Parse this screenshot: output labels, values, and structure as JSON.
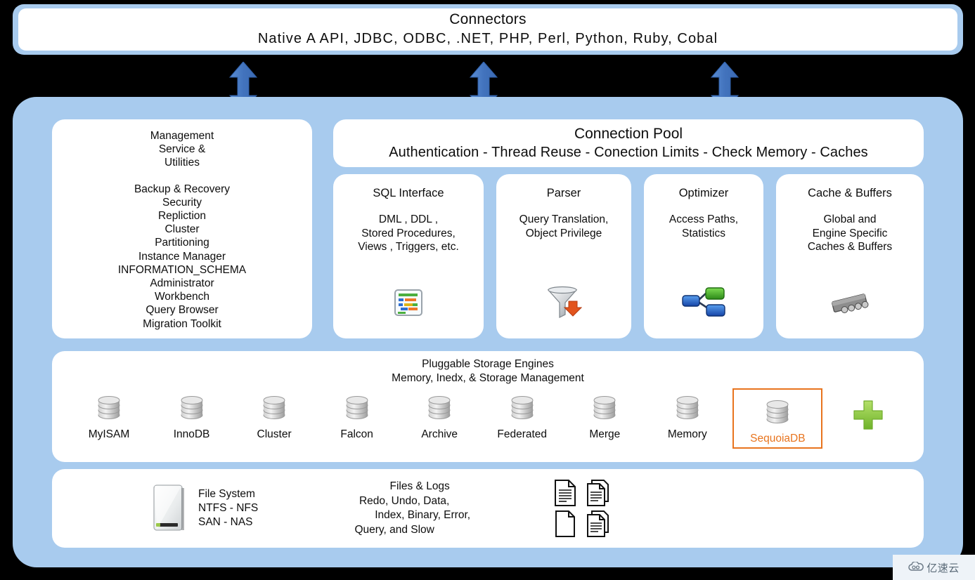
{
  "connectors": {
    "title": "Connectors",
    "list": "Native A API,  JDBC,  ODBC,  .NET,  PHP,  Perl,  Python,  Ruby,  Cobal"
  },
  "arrows": {
    "icon": "double-headed-vertical-arrow",
    "color": "#4a7ec7",
    "count": 3
  },
  "management": {
    "heading_lines": [
      "Management",
      "Service &",
      "Utilities"
    ],
    "items": [
      "Backup & Recovery",
      "Security",
      "Repliction",
      "Cluster",
      "Partitioning",
      "Instance Manager",
      "INFORMATION_SCHEMA",
      "Administrator",
      "Workbench",
      "Query Browser",
      "Migration Toolkit"
    ]
  },
  "connection_pool": {
    "title": "Connection Pool",
    "subtitle": "Authentication - Thread Reuse - Conection Limits - Check Memory - Caches"
  },
  "cards": [
    {
      "title": "SQL Interface",
      "body": [
        "DML , DDL ,",
        "Stored Procedures,",
        "Views , Triggers, etc."
      ],
      "icon": "gantt-chart-icon"
    },
    {
      "title": "Parser",
      "body": [
        "Query Translation,",
        "Object Privilege"
      ],
      "icon": "funnel-download-icon"
    },
    {
      "title": "Optimizer",
      "body": [
        "Access Paths,",
        "Statistics"
      ],
      "icon": "node-tree-icon"
    },
    {
      "title": "Cache & Buffers",
      "body": [
        "Global and",
        "Engine Specific",
        "Caches & Buffers"
      ],
      "icon": "memory-chip-icon"
    }
  ],
  "storage": {
    "title": "Pluggable Storage Engines",
    "subtitle": "Memory, Inedx, & Storage Management",
    "highlight_color": "#e8741e",
    "engines": [
      {
        "name": "MyISAM",
        "icon": "database-cylinder-icon",
        "highlighted": false
      },
      {
        "name": "InnoDB",
        "icon": "database-cylinder-icon",
        "highlighted": false
      },
      {
        "name": "Cluster",
        "icon": "database-cylinder-icon",
        "highlighted": false
      },
      {
        "name": "Falcon",
        "icon": "database-cylinder-icon",
        "highlighted": false
      },
      {
        "name": "Archive",
        "icon": "database-cylinder-icon",
        "highlighted": false
      },
      {
        "name": "Federated",
        "icon": "database-cylinder-icon",
        "highlighted": false
      },
      {
        "name": "Merge",
        "icon": "database-cylinder-icon",
        "highlighted": false
      },
      {
        "name": "Memory",
        "icon": "database-cylinder-icon",
        "highlighted": false
      },
      {
        "name": "SequoiaDB",
        "icon": "database-cylinder-icon",
        "highlighted": true
      }
    ],
    "add_icon": "green-plus-icon"
  },
  "files": {
    "fs_icon": "hard-drive-icon",
    "fs_lines": [
      "File System",
      "NTFS - NFS",
      "SAN - NAS"
    ],
    "logs_title": "Files &  Logs",
    "logs_lines": [
      "Redo, Undo, Data,",
      "Index,  Binary,  Error,",
      "Query,  and  Slow"
    ],
    "doc_icons": [
      "document-icon",
      "documents-stack-icon",
      "blank-page-icon",
      "document-copy-icon"
    ]
  },
  "watermark": {
    "text": "亿速云",
    "icon": "cloud-logo-icon"
  }
}
